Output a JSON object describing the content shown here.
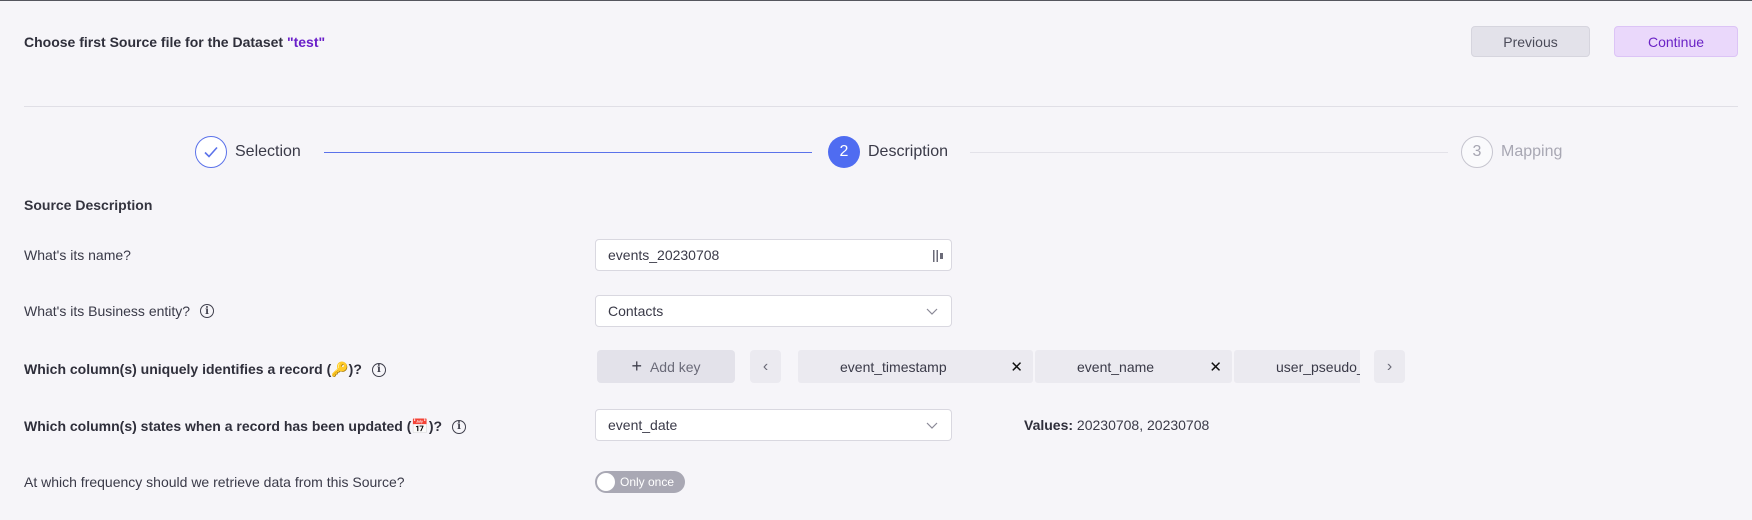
{
  "header": {
    "title_prefix": "Choose first Source file for the Dataset",
    "dataset_name": "\"test\"",
    "previous_label": "Previous",
    "continue_label": "Continue"
  },
  "stepper": {
    "steps": [
      {
        "number": "",
        "label": "Selection",
        "state": "done"
      },
      {
        "number": "2",
        "label": "Description",
        "state": "active"
      },
      {
        "number": "3",
        "label": "Mapping",
        "state": "pending"
      }
    ]
  },
  "section_title": "Source Description",
  "form": {
    "name_question": "What's its name?",
    "name_value": "events_20230708",
    "entity_question": "What's its Business entity?",
    "entity_value": "Contacts",
    "key_question": "Which column(s) uniquely identifies a record (🔑)?",
    "add_key_label": "Add key",
    "keys": [
      "event_timestamp",
      "event_name",
      "user_pseudo_id"
    ],
    "updated_question": "Which column(s) states when a record has been updated (📅)?",
    "updated_value": "event_date",
    "values_label": "Values:",
    "values_text": "20230708, 20230708",
    "frequency_question": "At which frequency should we retrieve data from this Source?",
    "frequency_value": "Only once"
  },
  "colors": {
    "accent": "#4f6cf1",
    "brand_purple": "#6a1fc9",
    "background": "#f6f5f9"
  }
}
